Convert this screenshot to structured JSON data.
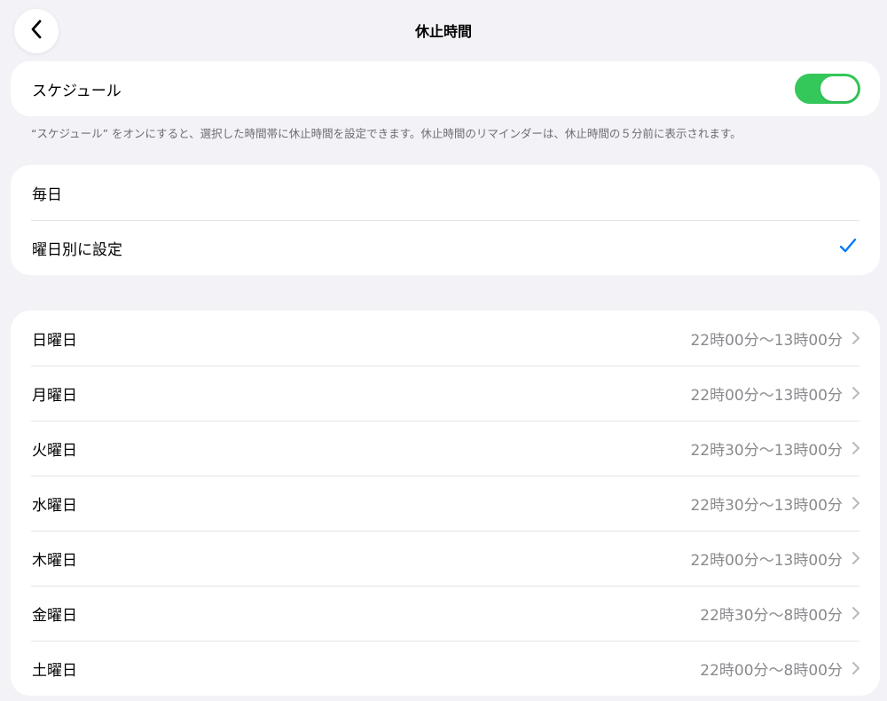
{
  "nav": {
    "title": "休止時間"
  },
  "schedule": {
    "label": "スケジュール",
    "enabled": true,
    "footnote": "“スケジュール” をオンにすると、選択した時間帯に休止時間を設定できます。休止時間のリマインダーは、休止時間の５分前に表示されます。"
  },
  "mode": {
    "options": [
      {
        "label": "毎日",
        "selected": false
      },
      {
        "label": "曜日別に設定",
        "selected": true
      }
    ]
  },
  "days": [
    {
      "label": "日曜日",
      "value": "22時00分～13時00分"
    },
    {
      "label": "月曜日",
      "value": "22時00分～13時00分"
    },
    {
      "label": "火曜日",
      "value": "22時30分～13時00分"
    },
    {
      "label": "水曜日",
      "value": "22時30分～13時00分"
    },
    {
      "label": "木曜日",
      "value": "22時00分～13時00分"
    },
    {
      "label": "金曜日",
      "value": "22時30分～8時00分"
    },
    {
      "label": "土曜日",
      "value": "22時00分～8時00分"
    }
  ],
  "colors": {
    "toggle_on": "#34c759",
    "check": "#007aff"
  },
  "icons": {
    "back": "chevron-left-icon",
    "check": "checkmark-icon",
    "disclosure": "chevron-right-icon"
  }
}
